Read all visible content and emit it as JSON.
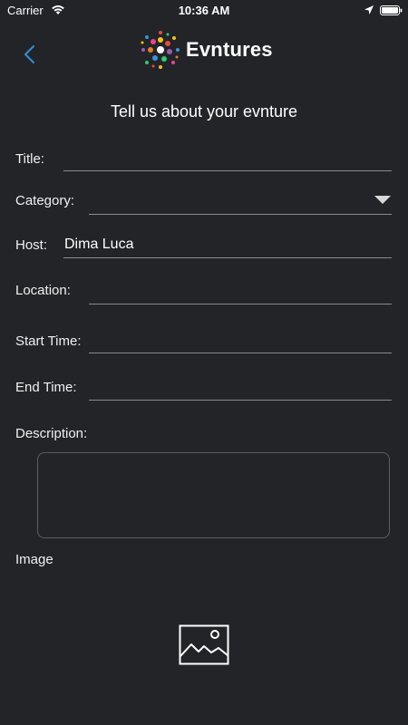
{
  "status_bar": {
    "carrier": "Carrier",
    "time": "10:36 AM"
  },
  "header": {
    "app_name": "Evntures",
    "page_title": "Tell us about your evnture"
  },
  "form": {
    "title_label": "Title:",
    "title_value": "",
    "category_label": "Category:",
    "category_value": "",
    "host_label": "Host:",
    "host_value": "Dima Luca",
    "location_label": "Location:",
    "location_value": "",
    "start_time_label": "Start Time:",
    "start_time_value": "",
    "end_time_label": "End Time:",
    "end_time_value": "",
    "description_label": "Description:",
    "description_value": "",
    "image_label": "Image"
  },
  "icons": {
    "back": "chevron-left-icon",
    "image_picker": "image-placeholder-icon",
    "dropdown": "triangle-down-icon"
  },
  "colors": {
    "background": "#232428",
    "accent": "#2f8fd8",
    "line": "#8a8b8f"
  }
}
